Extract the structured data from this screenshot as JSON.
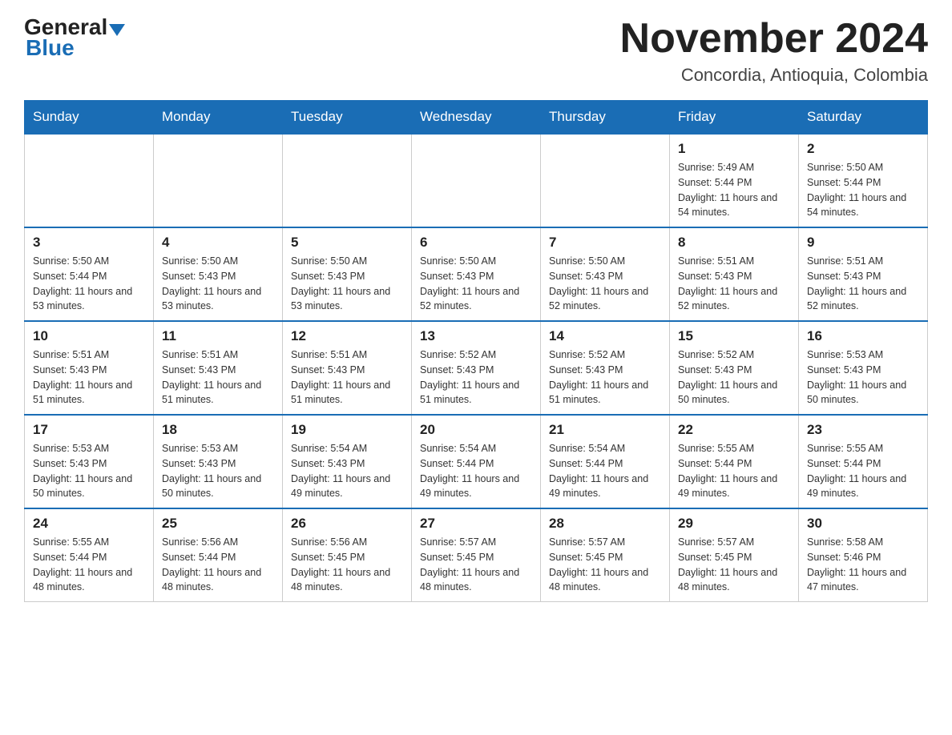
{
  "header": {
    "logo_general": "General",
    "logo_blue": "Blue",
    "month_title": "November 2024",
    "location": "Concordia, Antioquia, Colombia"
  },
  "days_of_week": [
    "Sunday",
    "Monday",
    "Tuesday",
    "Wednesday",
    "Thursday",
    "Friday",
    "Saturday"
  ],
  "weeks": [
    [
      {
        "day": "",
        "sunrise": "",
        "sunset": "",
        "daylight": "",
        "empty": true
      },
      {
        "day": "",
        "sunrise": "",
        "sunset": "",
        "daylight": "",
        "empty": true
      },
      {
        "day": "",
        "sunrise": "",
        "sunset": "",
        "daylight": "",
        "empty": true
      },
      {
        "day": "",
        "sunrise": "",
        "sunset": "",
        "daylight": "",
        "empty": true
      },
      {
        "day": "",
        "sunrise": "",
        "sunset": "",
        "daylight": "",
        "empty": true
      },
      {
        "day": "1",
        "sunrise": "Sunrise: 5:49 AM",
        "sunset": "Sunset: 5:44 PM",
        "daylight": "Daylight: 11 hours and 54 minutes.",
        "empty": false
      },
      {
        "day": "2",
        "sunrise": "Sunrise: 5:50 AM",
        "sunset": "Sunset: 5:44 PM",
        "daylight": "Daylight: 11 hours and 54 minutes.",
        "empty": false
      }
    ],
    [
      {
        "day": "3",
        "sunrise": "Sunrise: 5:50 AM",
        "sunset": "Sunset: 5:44 PM",
        "daylight": "Daylight: 11 hours and 53 minutes.",
        "empty": false
      },
      {
        "day": "4",
        "sunrise": "Sunrise: 5:50 AM",
        "sunset": "Sunset: 5:43 PM",
        "daylight": "Daylight: 11 hours and 53 minutes.",
        "empty": false
      },
      {
        "day": "5",
        "sunrise": "Sunrise: 5:50 AM",
        "sunset": "Sunset: 5:43 PM",
        "daylight": "Daylight: 11 hours and 53 minutes.",
        "empty": false
      },
      {
        "day": "6",
        "sunrise": "Sunrise: 5:50 AM",
        "sunset": "Sunset: 5:43 PM",
        "daylight": "Daylight: 11 hours and 52 minutes.",
        "empty": false
      },
      {
        "day": "7",
        "sunrise": "Sunrise: 5:50 AM",
        "sunset": "Sunset: 5:43 PM",
        "daylight": "Daylight: 11 hours and 52 minutes.",
        "empty": false
      },
      {
        "day": "8",
        "sunrise": "Sunrise: 5:51 AM",
        "sunset": "Sunset: 5:43 PM",
        "daylight": "Daylight: 11 hours and 52 minutes.",
        "empty": false
      },
      {
        "day": "9",
        "sunrise": "Sunrise: 5:51 AM",
        "sunset": "Sunset: 5:43 PM",
        "daylight": "Daylight: 11 hours and 52 minutes.",
        "empty": false
      }
    ],
    [
      {
        "day": "10",
        "sunrise": "Sunrise: 5:51 AM",
        "sunset": "Sunset: 5:43 PM",
        "daylight": "Daylight: 11 hours and 51 minutes.",
        "empty": false
      },
      {
        "day": "11",
        "sunrise": "Sunrise: 5:51 AM",
        "sunset": "Sunset: 5:43 PM",
        "daylight": "Daylight: 11 hours and 51 minutes.",
        "empty": false
      },
      {
        "day": "12",
        "sunrise": "Sunrise: 5:51 AM",
        "sunset": "Sunset: 5:43 PM",
        "daylight": "Daylight: 11 hours and 51 minutes.",
        "empty": false
      },
      {
        "day": "13",
        "sunrise": "Sunrise: 5:52 AM",
        "sunset": "Sunset: 5:43 PM",
        "daylight": "Daylight: 11 hours and 51 minutes.",
        "empty": false
      },
      {
        "day": "14",
        "sunrise": "Sunrise: 5:52 AM",
        "sunset": "Sunset: 5:43 PM",
        "daylight": "Daylight: 11 hours and 51 minutes.",
        "empty": false
      },
      {
        "day": "15",
        "sunrise": "Sunrise: 5:52 AM",
        "sunset": "Sunset: 5:43 PM",
        "daylight": "Daylight: 11 hours and 50 minutes.",
        "empty": false
      },
      {
        "day": "16",
        "sunrise": "Sunrise: 5:53 AM",
        "sunset": "Sunset: 5:43 PM",
        "daylight": "Daylight: 11 hours and 50 minutes.",
        "empty": false
      }
    ],
    [
      {
        "day": "17",
        "sunrise": "Sunrise: 5:53 AM",
        "sunset": "Sunset: 5:43 PM",
        "daylight": "Daylight: 11 hours and 50 minutes.",
        "empty": false
      },
      {
        "day": "18",
        "sunrise": "Sunrise: 5:53 AM",
        "sunset": "Sunset: 5:43 PM",
        "daylight": "Daylight: 11 hours and 50 minutes.",
        "empty": false
      },
      {
        "day": "19",
        "sunrise": "Sunrise: 5:54 AM",
        "sunset": "Sunset: 5:43 PM",
        "daylight": "Daylight: 11 hours and 49 minutes.",
        "empty": false
      },
      {
        "day": "20",
        "sunrise": "Sunrise: 5:54 AM",
        "sunset": "Sunset: 5:44 PM",
        "daylight": "Daylight: 11 hours and 49 minutes.",
        "empty": false
      },
      {
        "day": "21",
        "sunrise": "Sunrise: 5:54 AM",
        "sunset": "Sunset: 5:44 PM",
        "daylight": "Daylight: 11 hours and 49 minutes.",
        "empty": false
      },
      {
        "day": "22",
        "sunrise": "Sunrise: 5:55 AM",
        "sunset": "Sunset: 5:44 PM",
        "daylight": "Daylight: 11 hours and 49 minutes.",
        "empty": false
      },
      {
        "day": "23",
        "sunrise": "Sunrise: 5:55 AM",
        "sunset": "Sunset: 5:44 PM",
        "daylight": "Daylight: 11 hours and 49 minutes.",
        "empty": false
      }
    ],
    [
      {
        "day": "24",
        "sunrise": "Sunrise: 5:55 AM",
        "sunset": "Sunset: 5:44 PM",
        "daylight": "Daylight: 11 hours and 48 minutes.",
        "empty": false
      },
      {
        "day": "25",
        "sunrise": "Sunrise: 5:56 AM",
        "sunset": "Sunset: 5:44 PM",
        "daylight": "Daylight: 11 hours and 48 minutes.",
        "empty": false
      },
      {
        "day": "26",
        "sunrise": "Sunrise: 5:56 AM",
        "sunset": "Sunset: 5:45 PM",
        "daylight": "Daylight: 11 hours and 48 minutes.",
        "empty": false
      },
      {
        "day": "27",
        "sunrise": "Sunrise: 5:57 AM",
        "sunset": "Sunset: 5:45 PM",
        "daylight": "Daylight: 11 hours and 48 minutes.",
        "empty": false
      },
      {
        "day": "28",
        "sunrise": "Sunrise: 5:57 AM",
        "sunset": "Sunset: 5:45 PM",
        "daylight": "Daylight: 11 hours and 48 minutes.",
        "empty": false
      },
      {
        "day": "29",
        "sunrise": "Sunrise: 5:57 AM",
        "sunset": "Sunset: 5:45 PM",
        "daylight": "Daylight: 11 hours and 48 minutes.",
        "empty": false
      },
      {
        "day": "30",
        "sunrise": "Sunrise: 5:58 AM",
        "sunset": "Sunset: 5:46 PM",
        "daylight": "Daylight: 11 hours and 47 minutes.",
        "empty": false
      }
    ]
  ]
}
